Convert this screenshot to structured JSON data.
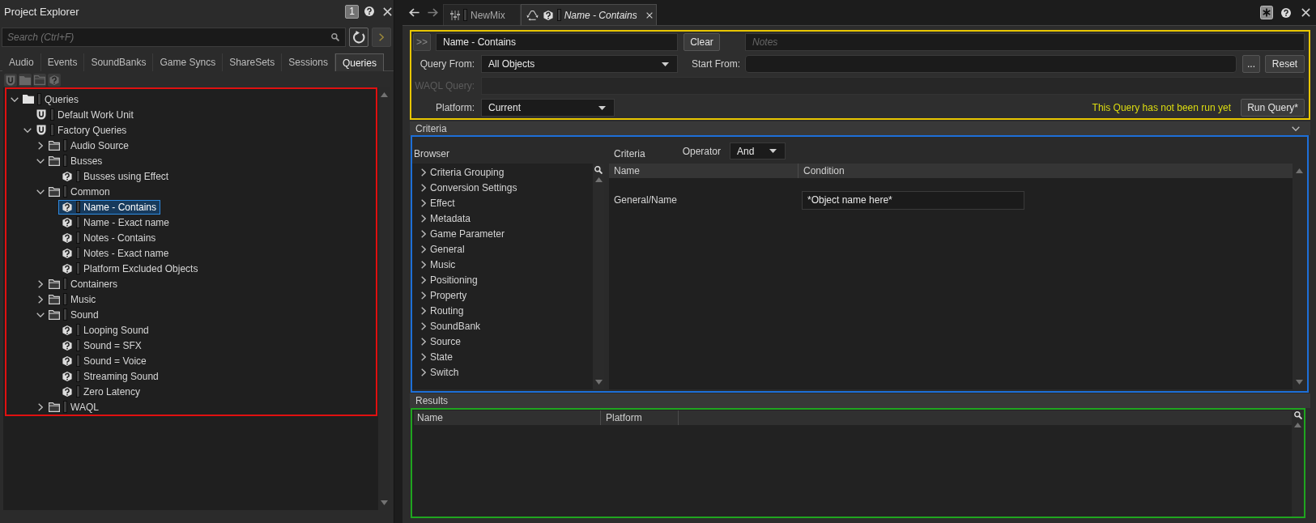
{
  "project_explorer": {
    "title": "Project Explorer",
    "view_number": "1",
    "search": {
      "placeholder": "Search (Ctrl+F)"
    },
    "tabs": [
      {
        "label": "Audio",
        "selected": false
      },
      {
        "label": "Events",
        "selected": false
      },
      {
        "label": "SoundBanks",
        "selected": false
      },
      {
        "label": "Game Syncs",
        "selected": false
      },
      {
        "label": "ShareSets",
        "selected": false
      },
      {
        "label": "Sessions",
        "selected": false
      },
      {
        "label": "Queries",
        "selected": true
      }
    ],
    "toolbar": [
      {
        "kind": "work-unit",
        "disabled": true
      },
      {
        "kind": "folder",
        "disabled": true
      },
      {
        "kind": "virtual-folder",
        "disabled": true
      },
      {
        "kind": "query",
        "disabled": true
      }
    ],
    "tree": [
      {
        "label": "Queries",
        "kind": "root",
        "expanded": true,
        "selected": false,
        "children": [
          {
            "label": "Default Work Unit",
            "kind": "work-unit",
            "selected": false
          },
          {
            "label": "Factory Queries",
            "kind": "work-unit",
            "expanded": true,
            "selected": false,
            "children": [
              {
                "label": "Audio Source",
                "kind": "folder",
                "expanded": false,
                "selected": false
              },
              {
                "label": "Busses",
                "kind": "folder",
                "expanded": true,
                "selected": false,
                "children": [
                  {
                    "label": "Busses using Effect",
                    "kind": "query",
                    "selected": false
                  }
                ]
              },
              {
                "label": "Common",
                "kind": "folder",
                "expanded": true,
                "selected": false,
                "children": [
                  {
                    "label": "Name - Contains",
                    "kind": "query",
                    "selected": true
                  },
                  {
                    "label": "Name - Exact name",
                    "kind": "query",
                    "selected": false
                  },
                  {
                    "label": "Notes - Contains",
                    "kind": "query",
                    "selected": false
                  },
                  {
                    "label": "Notes - Exact name",
                    "kind": "query",
                    "selected": false
                  },
                  {
                    "label": "Platform Excluded Objects",
                    "kind": "query",
                    "selected": false
                  }
                ]
              },
              {
                "label": "Containers",
                "kind": "folder",
                "expanded": false,
                "selected": false
              },
              {
                "label": "Music",
                "kind": "folder",
                "expanded": false,
                "selected": false
              },
              {
                "label": "Sound",
                "kind": "folder",
                "expanded": true,
                "selected": false,
                "children": [
                  {
                    "label": "Looping Sound",
                    "kind": "query",
                    "selected": false
                  },
                  {
                    "label": "Sound = SFX",
                    "kind": "query",
                    "selected": false
                  },
                  {
                    "label": "Sound = Voice",
                    "kind": "query",
                    "selected": false
                  },
                  {
                    "label": "Streaming Sound",
                    "kind": "query",
                    "selected": false
                  },
                  {
                    "label": "Zero Latency",
                    "kind": "query",
                    "selected": false
                  }
                ]
              },
              {
                "label": "WAQL",
                "kind": "folder",
                "expanded": false,
                "selected": false
              }
            ]
          }
        ]
      }
    ]
  },
  "editor": {
    "tabs": [
      {
        "label": "NewMix",
        "kind": "mixer",
        "selected": false
      },
      {
        "label": "Name - Contains",
        "kind": "query",
        "selected": true
      }
    ],
    "query": {
      "expand_button": ">>",
      "name": "Name - Contains",
      "clear_button": "Clear",
      "notes": {
        "placeholder": "Notes"
      },
      "query_from": {
        "label": "Query From:",
        "value": "All Objects"
      },
      "start_from": {
        "label": "Start From:"
      },
      "browse_button": "...",
      "reset_button": "Reset",
      "waql_query": {
        "label": "WAQL Query:",
        "disabled": true
      },
      "platform": {
        "label": "Platform:",
        "value": "Current"
      },
      "status": "This Query has not been run yet",
      "run_button": "Run Query*"
    },
    "criteria": {
      "title": "Criteria",
      "expanded": true,
      "browser": {
        "title": "Browser",
        "items": [
          {
            "label": "Criteria Grouping",
            "expanded": false
          },
          {
            "label": "Conversion Settings",
            "expanded": false
          },
          {
            "label": "Effect",
            "expanded": false
          },
          {
            "label": "Metadata",
            "expanded": false
          },
          {
            "label": "Game Parameter",
            "expanded": false
          },
          {
            "label": "General",
            "expanded": false
          },
          {
            "label": "Music",
            "expanded": false
          },
          {
            "label": "Positioning",
            "expanded": false
          },
          {
            "label": "Property",
            "expanded": false
          },
          {
            "label": "Routing",
            "expanded": false
          },
          {
            "label": "SoundBank",
            "expanded": false
          },
          {
            "label": "Source",
            "expanded": false
          },
          {
            "label": "State",
            "expanded": false
          },
          {
            "label": "Switch",
            "expanded": false
          }
        ]
      },
      "criteria_title": "Criteria",
      "operator": {
        "label": "Operator",
        "value": "And"
      },
      "columns": [
        "Name",
        "Condition"
      ],
      "rows": [
        {
          "name": "General/Name",
          "condition": "*Object name here*"
        }
      ]
    },
    "results": {
      "title": "Results",
      "columns": [
        "Name",
        "Platform"
      ]
    }
  }
}
